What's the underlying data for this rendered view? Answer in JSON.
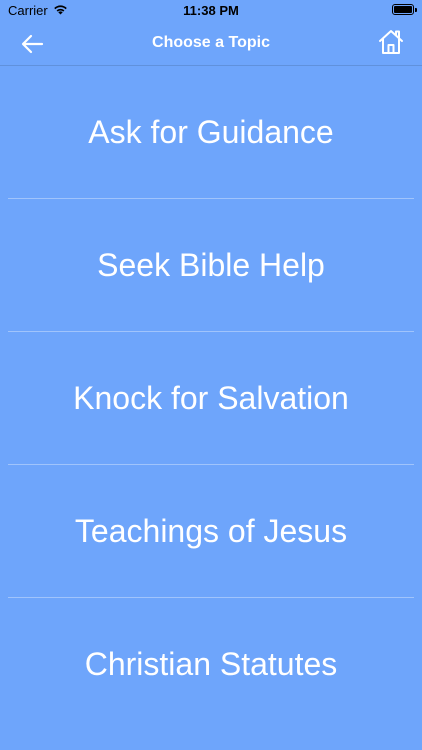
{
  "status_bar": {
    "carrier": "Carrier",
    "time": "11:38 PM",
    "icons": [
      "wifi-icon",
      "battery-icon"
    ]
  },
  "nav": {
    "title": "Choose a Topic",
    "back_icon": "arrow-left-icon",
    "home_icon": "home-icon"
  },
  "topics": [
    {
      "label": "Ask for Guidance"
    },
    {
      "label": "Seek Bible Help"
    },
    {
      "label": "Knock for Salvation"
    },
    {
      "label": "Teachings of Jesus"
    },
    {
      "label": "Christian Statutes"
    }
  ],
  "colors": {
    "background": "#6ea5fb",
    "text": "#ffffff",
    "status_text": "#000000"
  }
}
